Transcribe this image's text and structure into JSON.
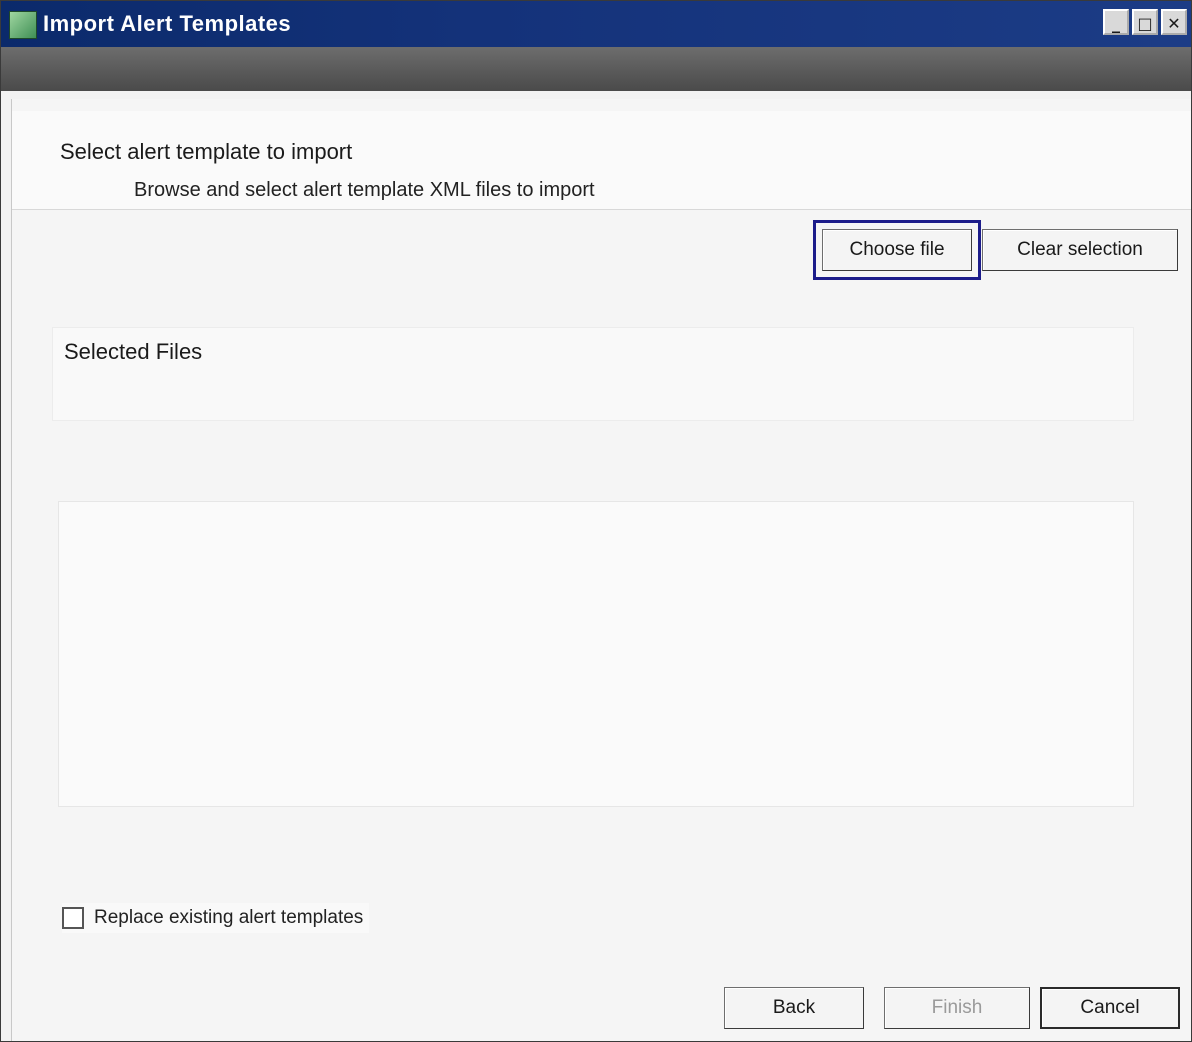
{
  "window": {
    "title": "Import Alert Templates",
    "minimize_glyph": "_",
    "maximize_glyph": "□",
    "close_glyph": "✕"
  },
  "header": {
    "heading": "Select alert template to import",
    "subheading": "Browse and select alert template XML files to import"
  },
  "actions": {
    "choose_file": "Choose file",
    "clear_selection": "Clear selection"
  },
  "selected_files": {
    "label": "Selected Files",
    "items": []
  },
  "options": {
    "replace_existing_label": "Replace existing alert templates",
    "replace_existing_checked": false
  },
  "footer": {
    "back": "Back",
    "finish": "Finish",
    "cancel": "Cancel"
  }
}
